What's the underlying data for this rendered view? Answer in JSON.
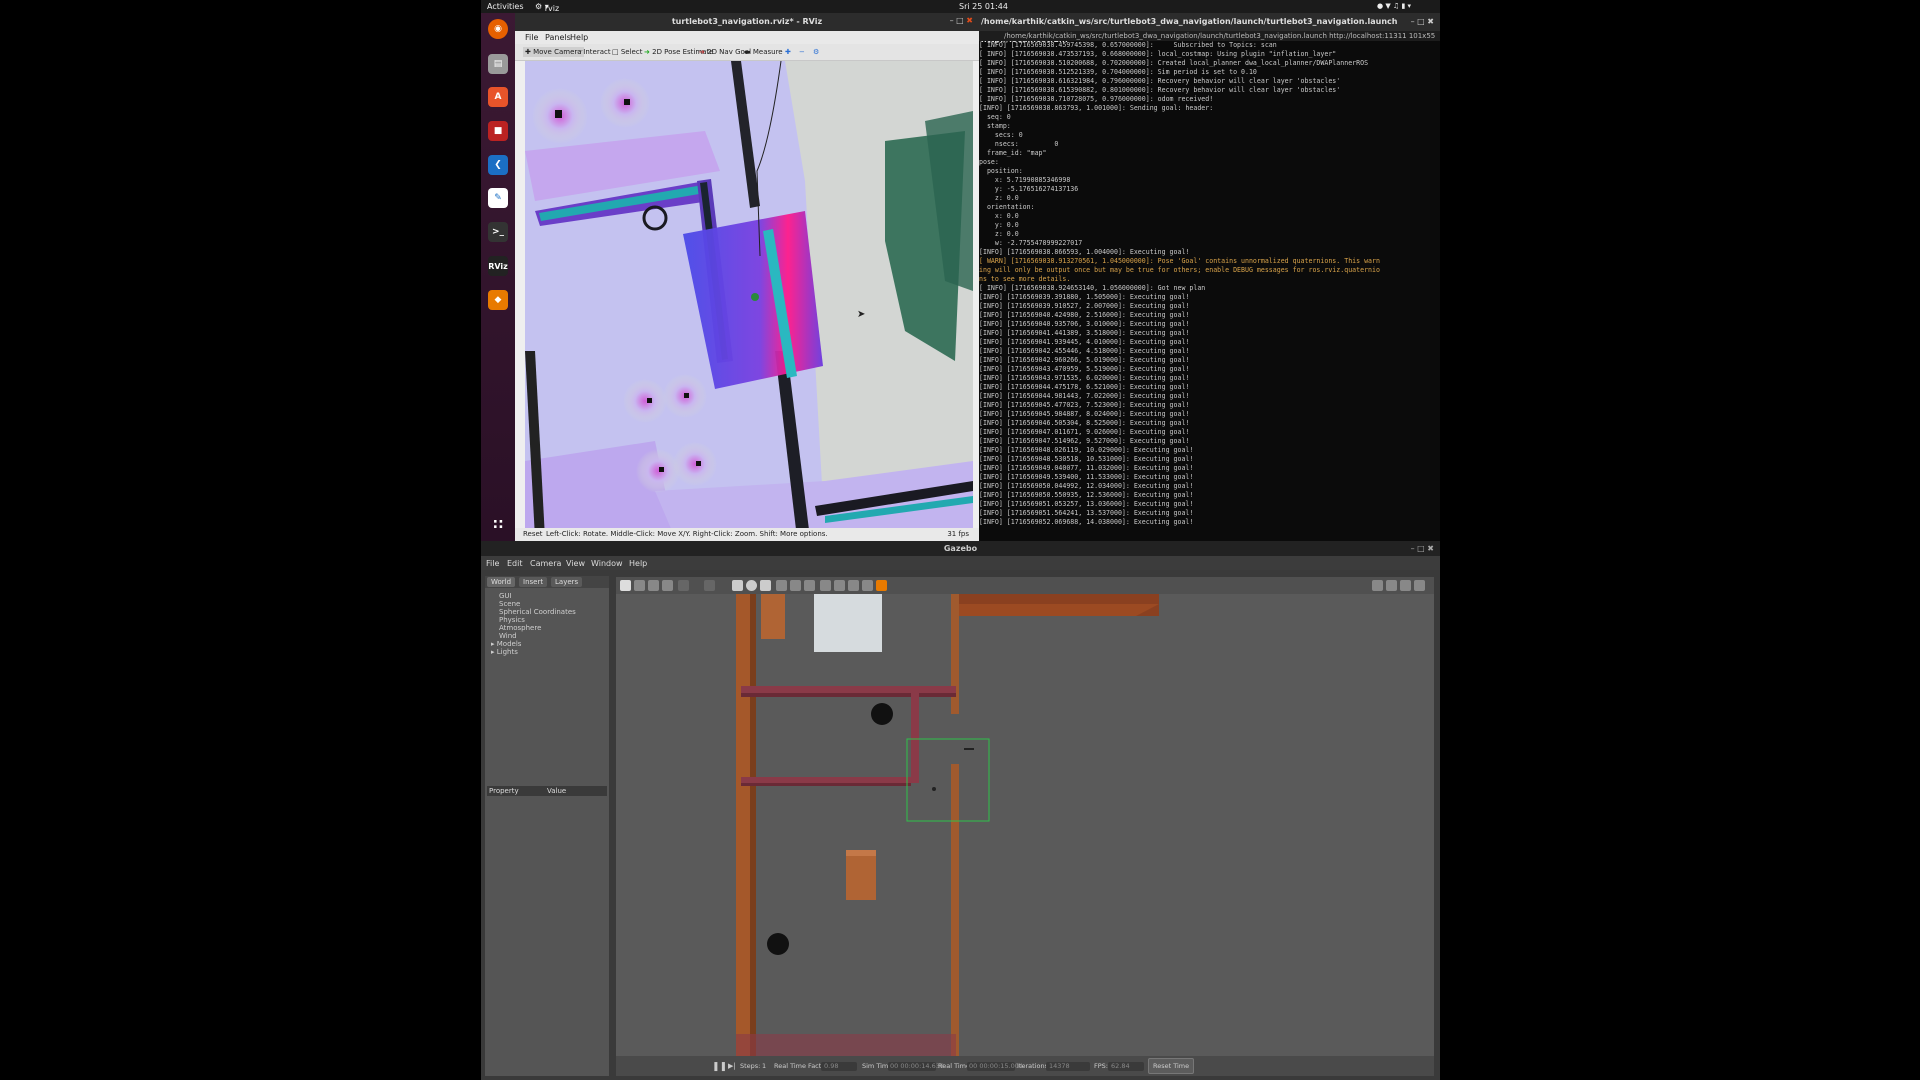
{
  "topbar": {
    "activities": "Activities",
    "app": "rviz",
    "clock": "Sri 25 01:44"
  },
  "dock": {
    "rviz_label": "RViz"
  },
  "rviz": {
    "title": "turtlebot3_navigation.rviz* - RViz",
    "menu": [
      "File",
      "Panels",
      "Help"
    ],
    "tools": [
      "Move Camera",
      "Interact",
      "Select",
      "2D Pose Estimate",
      "2D Nav Goal",
      "Measure"
    ],
    "status_reset": "Reset",
    "status_text": "Left-Click: Rotate. Middle-Click: Move X/Y. Right-Click: Zoom. Shift: More options.",
    "fps": "31 fps"
  },
  "terminal": {
    "title": "/home/karthik/catkin_ws/src/turtlebot3_dwa_navigation/launch/turtlebot3_navigation.launch http://localhost:1...",
    "tab": "/home/karthik/catkin_ws/src/turtlebot3_dwa_navigation/launch/turtlebot3_navigation.launch http://localhost:11311 101x55",
    "lines": [
      {
        "t": "[ INFO] [1716569038.459745398, 0.657000000]:     Subscribed to Topics: scan",
        "warn": false
      },
      {
        "t": "[ INFO] [1716569038.473537193, 0.668000000]: local_costmap: Using plugin \"inflation_layer\"",
        "warn": false
      },
      {
        "t": "[ INFO] [1716569038.510200688, 0.702000000]: Created local_planner dwa_local_planner/DWAPlannerROS",
        "warn": false
      },
      {
        "t": "[ INFO] [1716569038.512521339, 0.704000000]: Sim period is set to 0.10",
        "warn": false
      },
      {
        "t": "[ INFO] [1716569038.616321984, 0.796000000]: Recovery behavior will clear layer 'obstacles'",
        "warn": false
      },
      {
        "t": "[ INFO] [1716569038.615390882, 0.801000000]: Recovery behavior will clear layer 'obstacles'",
        "warn": false
      },
      {
        "t": "[ INFO] [1716569038.710728075, 0.976000000]: odom received!",
        "warn": false
      },
      {
        "t": "[INFO] [1716569038.863793, 1.001000]: Sending goal: header:",
        "warn": false
      },
      {
        "t": "  seq: 0",
        "warn": false
      },
      {
        "t": "  stamp:",
        "warn": false
      },
      {
        "t": "    secs: 0",
        "warn": false
      },
      {
        "t": "    nsecs:         0",
        "warn": false
      },
      {
        "t": "  frame_id: \"map\"",
        "warn": false
      },
      {
        "t": "pose:",
        "warn": false
      },
      {
        "t": "  position:",
        "warn": false
      },
      {
        "t": "    x: 5.71990885346998",
        "warn": false
      },
      {
        "t": "    y: -5.176516274137136",
        "warn": false
      },
      {
        "t": "    z: 0.0",
        "warn": false
      },
      {
        "t": "  orientation:",
        "warn": false
      },
      {
        "t": "    x: 0.0",
        "warn": false
      },
      {
        "t": "    y: 0.0",
        "warn": false
      },
      {
        "t": "    z: 0.0",
        "warn": false
      },
      {
        "t": "    w: -2.7755478999227017",
        "warn": false
      },
      {
        "t": "[INFO] [1716569038.866593, 1.004000]: Executing goal!",
        "warn": false
      },
      {
        "t": "[ WARN] [1716569038.913270561, 1.045000000]: Pose 'Goal' contains unnormalized quaternions. This warn",
        "warn": true
      },
      {
        "t": "ing will only be output once but may be true for others; enable DEBUG messages for ros.rviz.quaternio",
        "warn": true
      },
      {
        "t": "ns to see more details.",
        "warn": true
      },
      {
        "t": "[ INFO] [1716569038.924653140, 1.056000000]: Got new plan",
        "warn": false
      },
      {
        "t": "[INFO] [1716569039.391880, 1.505000]: Executing goal!",
        "warn": false
      },
      {
        "t": "[INFO] [1716569039.910527, 2.007000]: Executing goal!",
        "warn": false
      },
      {
        "t": "[INFO] [1716569040.424980, 2.516000]: Executing goal!",
        "warn": false
      },
      {
        "t": "[INFO] [1716569040.935706, 3.010000]: Executing goal!",
        "warn": false
      },
      {
        "t": "[INFO] [1716569041.441389, 3.518000]: Executing goal!",
        "warn": false
      },
      {
        "t": "[INFO] [1716569041.939445, 4.010000]: Executing goal!",
        "warn": false
      },
      {
        "t": "[INFO] [1716569042.455446, 4.518000]: Executing goal!",
        "warn": false
      },
      {
        "t": "[INFO] [1716569042.960266, 5.019000]: Executing goal!",
        "warn": false
      },
      {
        "t": "[INFO] [1716569043.470959, 5.519000]: Executing goal!",
        "warn": false
      },
      {
        "t": "[INFO] [1716569043.971535, 6.020000]: Executing goal!",
        "warn": false
      },
      {
        "t": "[INFO] [1716569044.475178, 6.521000]: Executing goal!",
        "warn": false
      },
      {
        "t": "[INFO] [1716569044.981443, 7.022000]: Executing goal!",
        "warn": false
      },
      {
        "t": "[INFO] [1716569045.477023, 7.523000]: Executing goal!",
        "warn": false
      },
      {
        "t": "[INFO] [1716569045.984887, 8.024000]: Executing goal!",
        "warn": false
      },
      {
        "t": "[INFO] [1716569046.505304, 8.525000]: Executing goal!",
        "warn": false
      },
      {
        "t": "[INFO] [1716569047.011671, 9.026000]: Executing goal!",
        "warn": false
      },
      {
        "t": "[INFO] [1716569047.514962, 9.527000]: Executing goal!",
        "warn": false
      },
      {
        "t": "[INFO] [1716569048.026119, 10.029000]: Executing goal!",
        "warn": false
      },
      {
        "t": "[INFO] [1716569048.530518, 10.531000]: Executing goal!",
        "warn": false
      },
      {
        "t": "[INFO] [1716569049.040077, 11.032000]: Executing goal!",
        "warn": false
      },
      {
        "t": "[INFO] [1716569049.539400, 11.533000]: Executing goal!",
        "warn": false
      },
      {
        "t": "[INFO] [1716569050.044992, 12.034000]: Executing goal!",
        "warn": false
      },
      {
        "t": "[INFO] [1716569050.550935, 12.536000]: Executing goal!",
        "warn": false
      },
      {
        "t": "[INFO] [1716569051.053257, 13.036000]: Executing goal!",
        "warn": false
      },
      {
        "t": "[INFO] [1716569051.564241, 13.537000]: Executing goal!",
        "warn": false
      },
      {
        "t": "[INFO] [1716569052.069688, 14.038000]: Executing goal!",
        "warn": false
      }
    ]
  },
  "gazebo": {
    "title": "Gazebo",
    "menu": [
      "File",
      "Edit",
      "Camera",
      "View",
      "Window",
      "Help"
    ],
    "tabs": [
      "World",
      "Insert",
      "Layers"
    ],
    "tree": [
      "GUI",
      "Scene",
      "Spherical Coordinates",
      "Physics",
      "Atmosphere",
      "Wind",
      "Models",
      "Lights"
    ],
    "prop_header": "Property",
    "value_header": "Value",
    "bottom": {
      "steps_label": "Steps:",
      "steps_value": "1",
      "rtf_label": "Real Time Factor:",
      "rtf_value": "0.98",
      "sim_label": "Sim Time:",
      "sim_value": "00 00:00:14.638",
      "real_label": "Real Time:",
      "real_value": "00 00:00:15.004",
      "iter_label": "Iterations:",
      "iter_value": "14378",
      "fps_label": "FPS:",
      "fps_value": "62.84",
      "reset": "Reset Time"
    }
  }
}
